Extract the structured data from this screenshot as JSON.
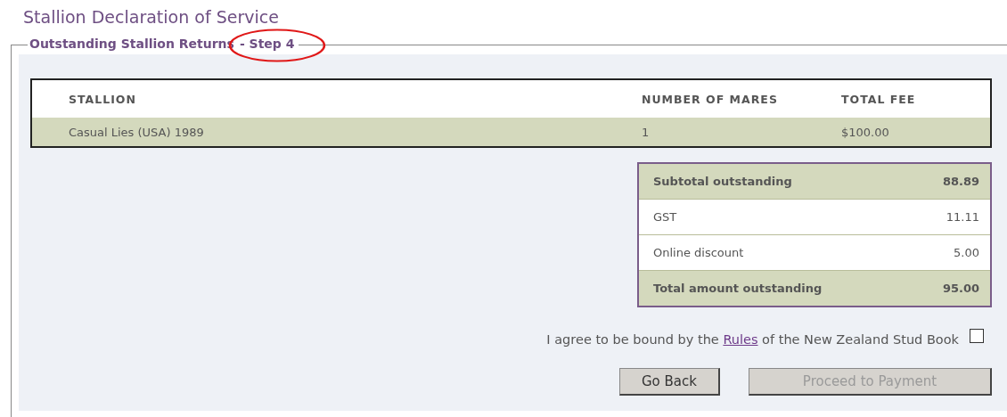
{
  "page_title": "Stallion Declaration of Service",
  "fieldset": {
    "legend": "Outstanding Stallion Returns",
    "step": "- Step 4",
    "step_highlighted": true
  },
  "table": {
    "columns": [
      "STALLION",
      "NUMBER OF MARES",
      "TOTAL FEE"
    ],
    "rows": [
      [
        "Casual Lies (USA) 1989",
        "1",
        "$100.00"
      ]
    ]
  },
  "summary": [
    {
      "kind": "subtotal",
      "label": "Subtotal outstanding",
      "value": "88.89"
    },
    {
      "kind": "line",
      "label": "GST",
      "value": "11.11"
    },
    {
      "kind": "line",
      "label": "Online discount",
      "value": "5.00"
    },
    {
      "kind": "total",
      "label": "Total amount outstanding",
      "value": "95.00"
    }
  ],
  "agreement": {
    "before": "I agree to be bound by the ",
    "link": "Rules",
    "after": " of the New Zealand Stud Book",
    "checked": false
  },
  "buttons": [
    {
      "label": "Go Back",
      "disabled": false
    },
    {
      "label": "Proceed to Payment",
      "disabled": true
    }
  ]
}
